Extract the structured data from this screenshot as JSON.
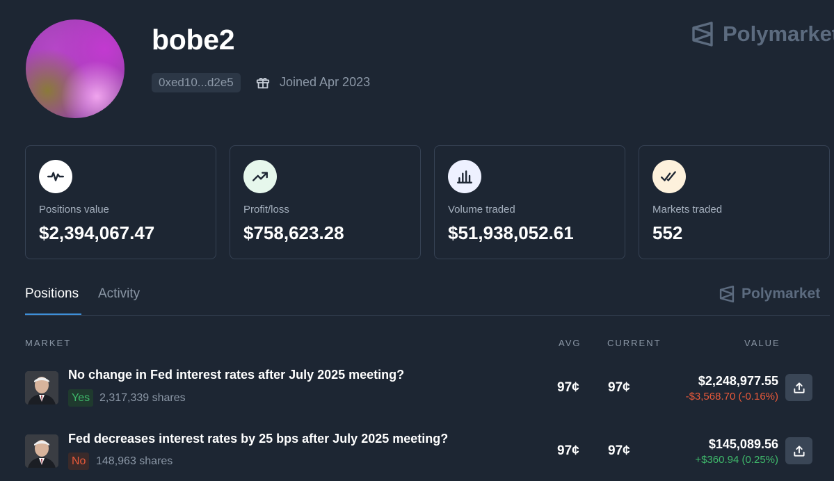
{
  "profile": {
    "username": "bobe2",
    "address": "0xed10...d2e5",
    "joined": "Joined Apr 2023"
  },
  "brand": {
    "name": "Polymarket",
    "color": "#5c6b7f"
  },
  "stats": [
    {
      "icon": "pulse-icon",
      "label": "Positions value",
      "value": "$2,394,067.47",
      "icon_bg": "#ffffff"
    },
    {
      "icon": "trending-up-icon",
      "label": "Profit/loss",
      "value": "$758,623.28",
      "icon_bg": "#e6f7ec"
    },
    {
      "icon": "bar-chart-icon",
      "label": "Volume traded",
      "value": "$51,938,052.61",
      "icon_bg": "#eef1ff"
    },
    {
      "icon": "double-check-icon",
      "label": "Markets traded",
      "value": "552",
      "icon_bg": "#fdf1dc"
    }
  ],
  "tabs": [
    {
      "label": "Positions",
      "active": true
    },
    {
      "label": "Activity",
      "active": false
    }
  ],
  "columns": {
    "market": "MARKET",
    "avg": "AVG",
    "current": "CURRENT",
    "value": "VALUE"
  },
  "positions": [
    {
      "title": "No change in Fed interest rates after July 2025 meeting?",
      "outcome": "Yes",
      "shares": "2,317,339 shares",
      "avg": "97¢",
      "current": "97¢",
      "value": "$2,248,977.55",
      "change": "-$3,568.70 (-0.16%)"
    },
    {
      "title": "Fed decreases interest rates by 25 bps after July 2025 meeting?",
      "outcome": "No",
      "shares": "148,963 shares",
      "avg": "97¢",
      "current": "97¢",
      "value": "$145,089.56",
      "change": "+$360.94 (0.25%)"
    }
  ],
  "colors": {
    "background": "#1d2633",
    "accent": "#3e8fd8",
    "positive": "#3fb96b",
    "negative": "#e8593a"
  }
}
